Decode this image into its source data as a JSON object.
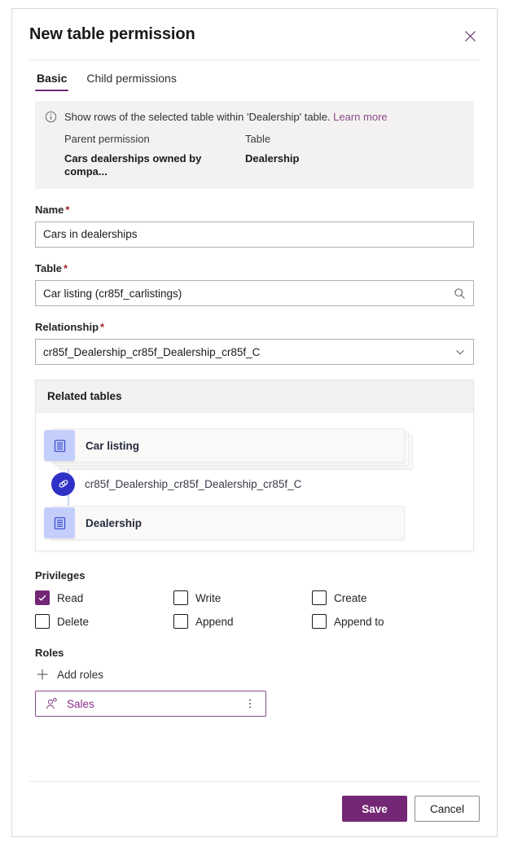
{
  "panel": {
    "title": "New table permission",
    "close_icon": "close-icon"
  },
  "tabs": [
    {
      "label": "Basic",
      "active": true
    },
    {
      "label": "Child permissions",
      "active": false
    }
  ],
  "info_banner": {
    "icon": "info-icon",
    "message": "Show rows of the selected table within 'Dealership' table.",
    "learn_more_label": "Learn more",
    "columns": [
      {
        "label": "Parent permission",
        "value": "Cars dealerships owned by compa..."
      },
      {
        "label": "Table",
        "value": "Dealership"
      }
    ]
  },
  "fields": {
    "name": {
      "label": "Name",
      "required_marker": "*",
      "value": "Cars in dealerships",
      "placeholder": "Name"
    },
    "table": {
      "label": "Table",
      "required_marker": "*",
      "value": "Car listing (cr85f_carlistings)",
      "trailing_icon": "search-icon"
    },
    "relationship": {
      "label": "Relationship",
      "required_marker": "*",
      "value": "cr85f_Dealership_cr85f_Dealership_cr85f_C",
      "trailing_icon": "chevron-down-icon"
    }
  },
  "related_tables": {
    "header": "Related tables",
    "source_node": {
      "label": "Car listing",
      "icon": "table-icon",
      "stacked": true
    },
    "relationship_node": {
      "label": "cr85f_Dealership_cr85f_Dealership_cr85f_C",
      "icon": "link-icon"
    },
    "target_node": {
      "label": "Dealership",
      "icon": "table-icon",
      "stacked": false
    }
  },
  "privileges": {
    "label": "Privileges",
    "items": [
      {
        "label": "Read",
        "checked": true
      },
      {
        "label": "Write",
        "checked": false
      },
      {
        "label": "Create",
        "checked": false
      },
      {
        "label": "Delete",
        "checked": false
      },
      {
        "label": "Append",
        "checked": false
      },
      {
        "label": "Append to",
        "checked": false
      }
    ]
  },
  "roles": {
    "label": "Roles",
    "add_label": "Add roles",
    "add_icon": "plus-icon",
    "chips": [
      {
        "name": "Sales",
        "icon": "person-icon",
        "more_icon": "more-vertical-icon"
      }
    ]
  },
  "footer": {
    "save_label": "Save",
    "cancel_label": "Cancel"
  },
  "colors": {
    "accent": "#742774",
    "link": "#8c4a8c",
    "required": "#a4262c",
    "node_icon_bg": "#c3cefb",
    "relationship_icon_bg": "#2f31c6",
    "banner_bg": "#f3f2f1"
  }
}
